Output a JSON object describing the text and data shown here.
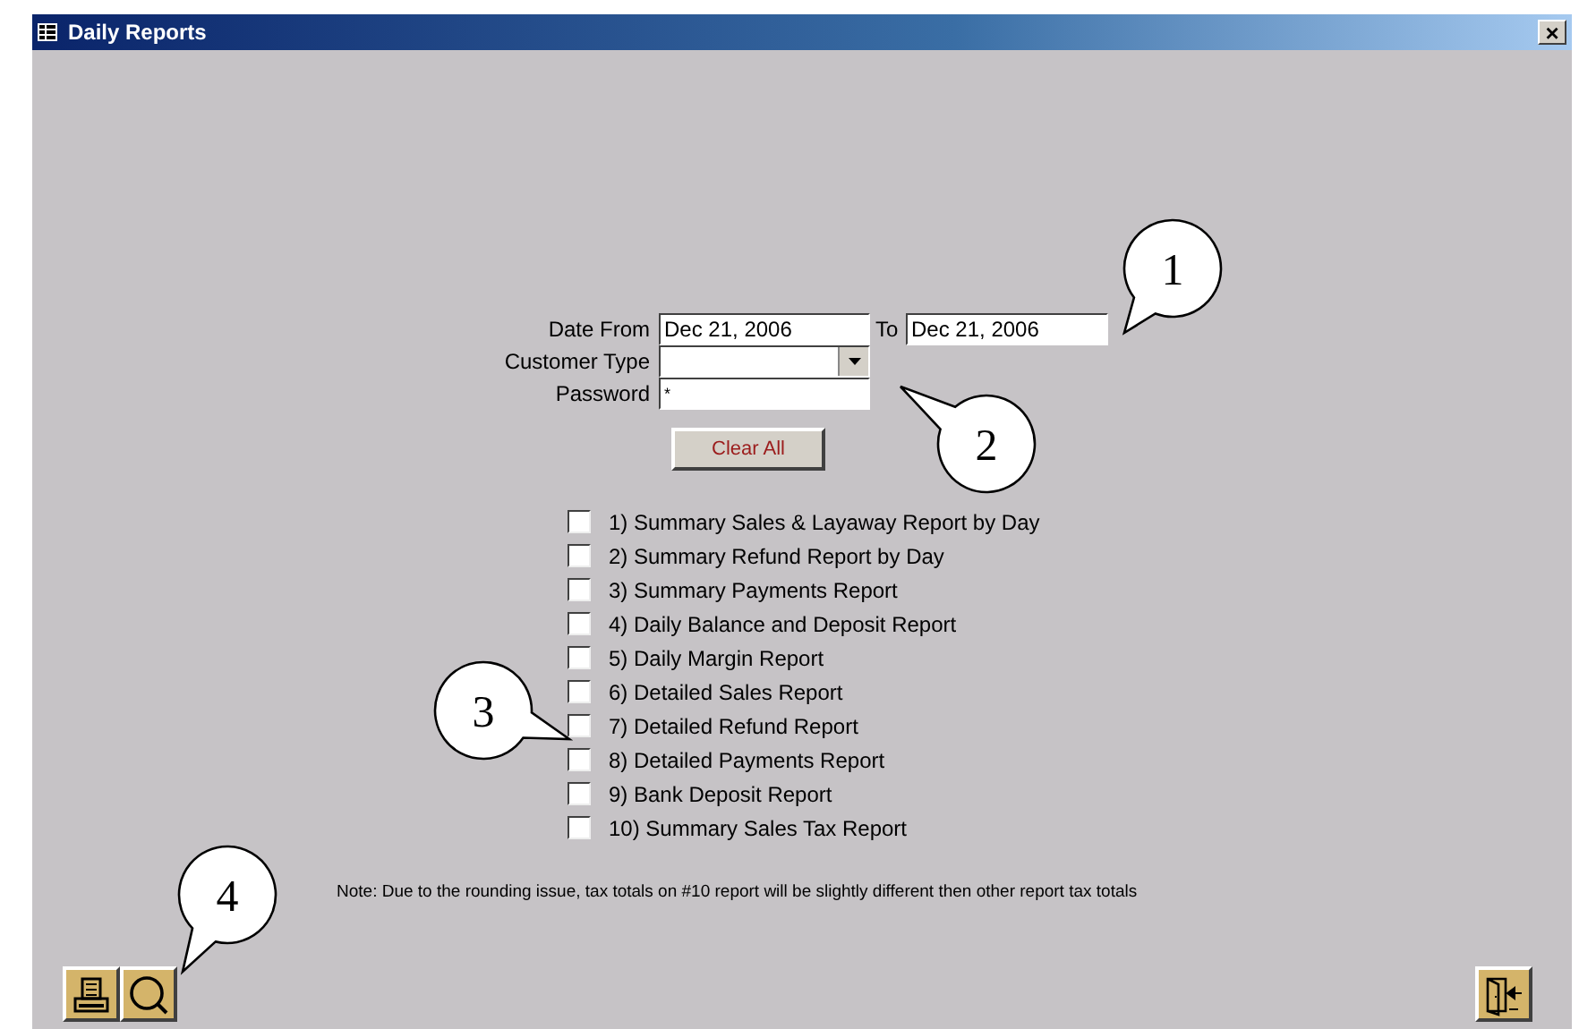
{
  "window": {
    "title": "Daily Reports",
    "close": "×"
  },
  "form": {
    "date_from_label": "Date From",
    "date_from": "Dec 21, 2006",
    "to_label": "To",
    "date_to": "Dec 21, 2006",
    "customer_type_label": "Customer Type",
    "password_label": "Password",
    "password": "*",
    "clear_button": "Clear All"
  },
  "reports": [
    {
      "label": "1) Summary Sales & Layaway Report by Day",
      "checked": false
    },
    {
      "label": "2) Summary Refund Report by Day",
      "checked": false
    },
    {
      "label": "3) Summary Payments Report",
      "checked": false
    },
    {
      "label": "4) Daily Balance and Deposit Report",
      "checked": false
    },
    {
      "label": "5) Daily Margin Report",
      "checked": false
    },
    {
      "label": "6) Detailed Sales Report",
      "checked": false
    },
    {
      "label": "7) Detailed Refund Report",
      "checked": false
    },
    {
      "label": "8) Detailed Payments Report",
      "checked": false
    },
    {
      "label": "9) Bank Deposit Report",
      "checked": false
    },
    {
      "label": "10) Summary Sales Tax Report",
      "checked": false
    }
  ],
  "note": "Note: Due to the rounding issue, tax totals on #10 report will be slightly different then other report tax totals",
  "callouts": [
    {
      "number": "1"
    },
    {
      "number": "2"
    },
    {
      "number": "3"
    },
    {
      "number": "4"
    }
  ]
}
